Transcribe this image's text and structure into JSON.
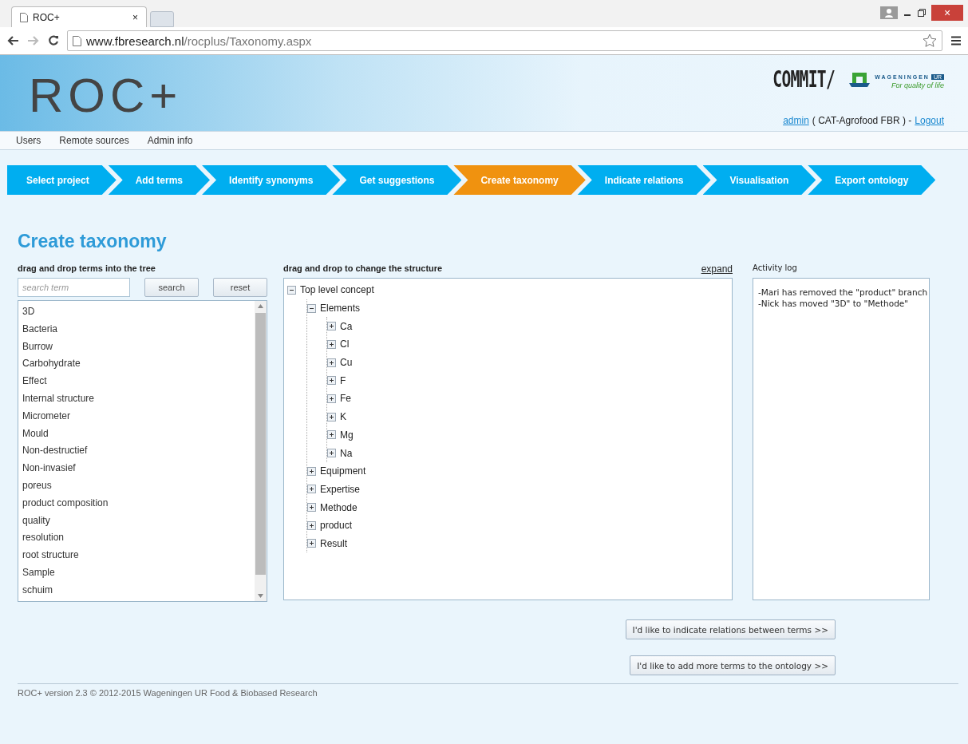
{
  "browser": {
    "tab_title": "ROC+",
    "tab_close": "×",
    "url_host": "www.fbresearch.nl",
    "url_path": "/rocplus/Taxonomy.aspx",
    "window_close": "×"
  },
  "header": {
    "logo": "ROC+",
    "commit_logo": "COMMIT/",
    "wur_name": "WAGENINGEN",
    "wur_suffix": "UR",
    "wur_tagline": "For quality of life",
    "user_link": "admin",
    "user_org": "( CAT-Agrofood FBR )  -",
    "logout_link": "Logout"
  },
  "admin_menu": [
    "Users",
    "Remote sources",
    "Admin info"
  ],
  "steps": [
    {
      "label": "Select project",
      "selected": false
    },
    {
      "label": "Add terms",
      "selected": false
    },
    {
      "label": "Identify synonyms",
      "selected": false
    },
    {
      "label": "Get suggestions",
      "selected": false
    },
    {
      "label": "Create taxonomy",
      "selected": true
    },
    {
      "label": "Indicate relations",
      "selected": false
    },
    {
      "label": "Visualisation",
      "selected": false
    },
    {
      "label": "Export ontology",
      "selected": false
    }
  ],
  "page_title": "Create taxonomy",
  "terms_panel": {
    "heading": "drag and drop terms into the tree",
    "search_placeholder": "search term",
    "search_button": "search",
    "reset_button": "reset",
    "terms": [
      "3D",
      "Bacteria",
      "Burrow",
      "Carbohydrate",
      "Effect",
      "Internal structure",
      "Micrometer",
      "Mould",
      "Non-destructief",
      "Non-invasief",
      "poreus",
      "product composition",
      "quality",
      "resolution",
      "root structure",
      "Sample",
      "schuim"
    ]
  },
  "tree_panel": {
    "heading": "drag and drop to change the structure",
    "expand_link": "expand",
    "tree": [
      {
        "label": "Top level concept",
        "expanded": true,
        "children": [
          {
            "label": "Elements",
            "expanded": true,
            "children": [
              {
                "label": "Ca",
                "expanded": false
              },
              {
                "label": "Cl",
                "expanded": false
              },
              {
                "label": "Cu",
                "expanded": false
              },
              {
                "label": "F",
                "expanded": false
              },
              {
                "label": "Fe",
                "expanded": false
              },
              {
                "label": "K",
                "expanded": false
              },
              {
                "label": "Mg",
                "expanded": false
              },
              {
                "label": "Na",
                "expanded": false
              }
            ]
          },
          {
            "label": "Equipment",
            "expanded": false
          },
          {
            "label": "Expertise",
            "expanded": false
          },
          {
            "label": "Methode",
            "expanded": false
          },
          {
            "label": "product",
            "expanded": false
          },
          {
            "label": "Result",
            "expanded": false
          }
        ]
      }
    ]
  },
  "activity_log": {
    "heading": "Activity log",
    "entries": [
      "-Mari has removed the \"product\" branch",
      "-Nick has moved \"3D\" to \"Methode\""
    ]
  },
  "action_buttons": [
    "I'd like to indicate relations between terms >>",
    "I'd like to add more terms to the ontology >>"
  ],
  "footer": "ROC+ version 2.3 © 2012-2015 Wageningen UR Food & Biobased Research"
}
